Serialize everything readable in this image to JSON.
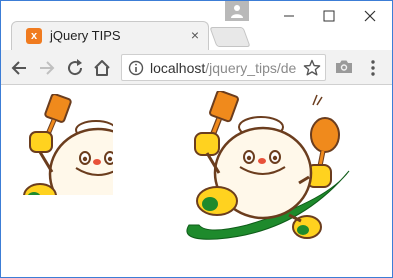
{
  "tab": {
    "favicon_letter": "x",
    "title": "jQuery TIPS",
    "close_glyph": "×"
  },
  "toolbar": {
    "url_host": "localhost",
    "url_path": "/jquery_tips/de"
  },
  "content": {
    "images": [
      {
        "name": "cropped mascot image"
      },
      {
        "name": "full mascot image"
      }
    ]
  },
  "colors": {
    "accent": "#3c7dd6",
    "favicon": "#f07b1f",
    "mascot_orange": "#f08a1c",
    "mascot_yellow": "#ffd21f",
    "mascot_green": "#1e8a2c",
    "mascot_brown": "#6b3d1e"
  }
}
